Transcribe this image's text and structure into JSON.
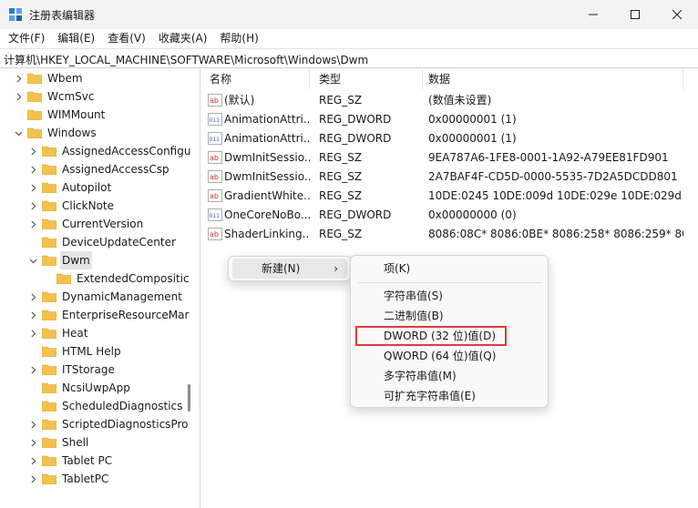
{
  "window": {
    "title": "注册表编辑器",
    "minimize_label": "—",
    "maximize_label": "☐",
    "close_label": "✕"
  },
  "menu": [
    "文件(F)",
    "编辑(E)",
    "查看(V)",
    "收藏夹(A)",
    "帮助(H)"
  ],
  "address": "计算机\\HKEY_LOCAL_MACHINE\\SOFTWARE\\Microsoft\\Windows\\Dwm",
  "tree": [
    {
      "label": "Wbem",
      "expanded": false,
      "level": 0
    },
    {
      "label": "WcmSvc",
      "expanded": false,
      "level": 0
    },
    {
      "label": "WIMMount",
      "expanded": null,
      "level": 0
    },
    {
      "label": "Windows",
      "expanded": true,
      "level": 0
    },
    {
      "label": "AssignedAccessConfigu",
      "expanded": false,
      "level": 1
    },
    {
      "label": "AssignedAccessCsp",
      "expanded": false,
      "level": 1
    },
    {
      "label": "Autopilot",
      "expanded": false,
      "level": 1
    },
    {
      "label": "ClickNote",
      "expanded": false,
      "level": 1
    },
    {
      "label": "CurrentVersion",
      "expanded": false,
      "level": 1
    },
    {
      "label": "DeviceUpdateCenter",
      "expanded": null,
      "level": 1
    },
    {
      "label": "Dwm",
      "expanded": true,
      "level": 1,
      "selected": true
    },
    {
      "label": "ExtendedCompositic",
      "expanded": null,
      "level": 2
    },
    {
      "label": "DynamicManagement",
      "expanded": false,
      "level": 1
    },
    {
      "label": "EnterpriseResourceMar",
      "expanded": false,
      "level": 1
    },
    {
      "label": "Heat",
      "expanded": false,
      "level": 1
    },
    {
      "label": "HTML Help",
      "expanded": null,
      "level": 1
    },
    {
      "label": "ITStorage",
      "expanded": false,
      "level": 1
    },
    {
      "label": "NcsiUwpApp",
      "expanded": null,
      "level": 1
    },
    {
      "label": "ScheduledDiagnostics",
      "expanded": null,
      "level": 1
    },
    {
      "label": "ScriptedDiagnosticsPro",
      "expanded": false,
      "level": 1
    },
    {
      "label": "Shell",
      "expanded": false,
      "level": 1
    },
    {
      "label": "Tablet PC",
      "expanded": false,
      "level": 1
    },
    {
      "label": "TabletPC",
      "expanded": false,
      "level": 1
    }
  ],
  "list": {
    "headers": {
      "name": "名称",
      "type": "类型",
      "data": "数据"
    },
    "rows": [
      {
        "icon": "string-value-icon",
        "name": "(默认)",
        "type": "REG_SZ",
        "data": "(数值未设置)"
      },
      {
        "icon": "binary-value-icon",
        "name": "AnimationAttri...",
        "type": "REG_DWORD",
        "data": "0x00000001 (1)"
      },
      {
        "icon": "binary-value-icon",
        "name": "AnimationAttri...",
        "type": "REG_DWORD",
        "data": "0x00000001 (1)"
      },
      {
        "icon": "string-value-icon",
        "name": "DwmInitSessio...",
        "type": "REG_SZ",
        "data": "9EA787A6-1FE8-0001-1A92-A79EE81FD901"
      },
      {
        "icon": "string-value-icon",
        "name": "DwmInitSessio...",
        "type": "REG_SZ",
        "data": "2A7BAF4F-CD5D-0000-5535-7D2A5DCDD801"
      },
      {
        "icon": "string-value-icon",
        "name": "GradientWhite...",
        "type": "REG_SZ",
        "data": "10DE:0245 10DE:009d 10DE:029e 10DE:029d ..."
      },
      {
        "icon": "binary-value-icon",
        "name": "OneCoreNoBo...",
        "type": "REG_DWORD",
        "data": "0x00000000 (0)"
      },
      {
        "icon": "string-value-icon",
        "name": "ShaderLinking...",
        "type": "REG_SZ",
        "data": "8086:08C* 8086:0BE* 8086:258* 8086:259* 808..."
      }
    ]
  },
  "context_menu": {
    "new_label": "新建(N)",
    "arrow": "›",
    "submenu": [
      "项(K)",
      "字符串值(S)",
      "二进制值(B)",
      "DWORD (32 位)值(D)",
      "QWORD (64 位)值(Q)",
      "多字符串值(M)",
      "可扩充字符串值(E)"
    ],
    "highlighted_index": 3
  },
  "colors": {
    "folder": "#f2c14e",
    "folder_dark": "#d9a430",
    "highlight_border": "#e03b3b",
    "string_icon": "#c0392b",
    "binary_icon": "#2a5db0"
  }
}
